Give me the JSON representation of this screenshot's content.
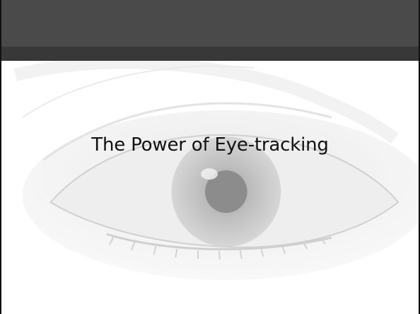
{
  "slide": {
    "title": "The Power of Eye-tracking"
  },
  "colors": {
    "header": "#4a4a4a",
    "header_band": "#383838",
    "background": "#ffffff",
    "eye_tint": "#d9d9d9",
    "text": "#111111"
  },
  "icons": {
    "background_image": "eye-illustration"
  }
}
